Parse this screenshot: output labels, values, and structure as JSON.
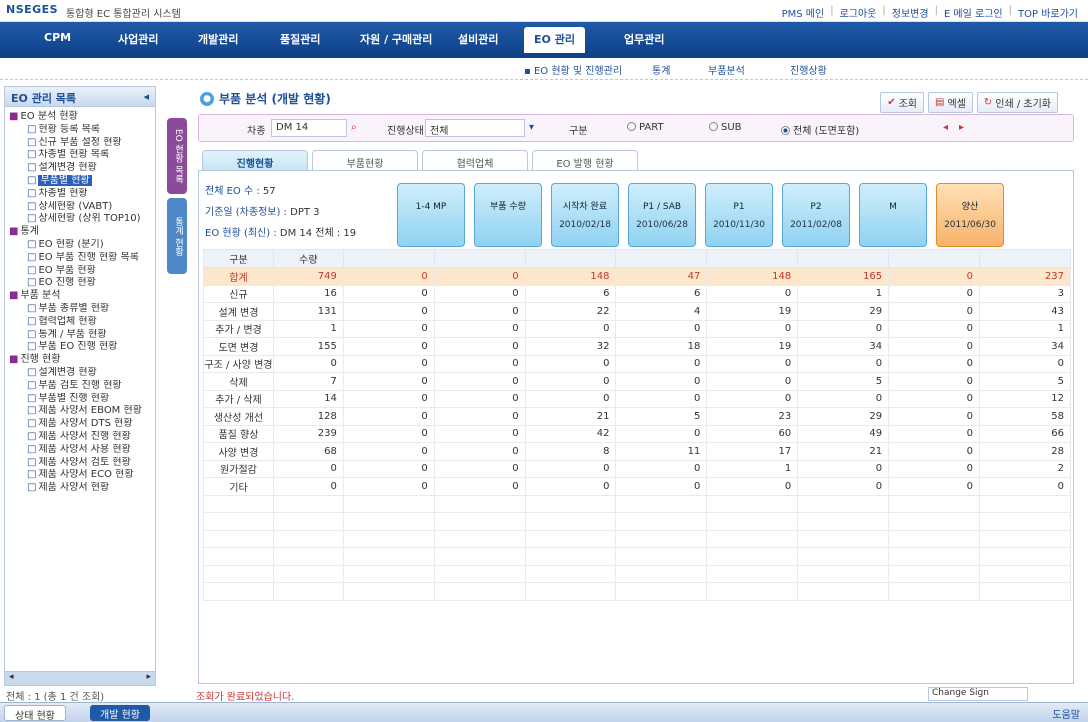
{
  "header": {
    "logo": "NSEGES",
    "title": "통합형 EC 통합관리 시스템",
    "links": [
      "PMS 메인",
      "로그아웃",
      "정보변경",
      "E 메일 로그인",
      "TOP 바로가기"
    ]
  },
  "mainnav": {
    "items": [
      "CPM",
      "사업관리",
      "개발관리",
      "품질관리",
      "자원 / 구매관리",
      "설비관리",
      "EO 관리",
      "업무관리"
    ],
    "active_index": 6
  },
  "subnav": {
    "items": [
      "EO 현황 및 진행관리",
      "통계",
      "부품분석",
      "진행상황"
    ],
    "active_index": 0
  },
  "left_panel": {
    "title": "EO 관리 목록",
    "tree": [
      {
        "group": "EO 분석 현황",
        "leaves": [
          "현황 등록 목록",
          "신규 부품 설정 현황",
          "차종별 현황 목록",
          "설계변경 현황",
          "부품별 현황",
          "차종별 현황",
          "상세현황 (VABT)",
          "상세현황 (상위 TOP10)"
        ],
        "selected": 4
      },
      {
        "group": "통계",
        "leaves": [
          "EO 현황 (분기)",
          "EO 부품 진행 현황 목록",
          "EO 부품 현황",
          "EO 진행 현황"
        ],
        "selected": -1
      },
      {
        "group": "부품 분석",
        "leaves": [
          "부품 종류별 현황",
          "협력업체 현황",
          "통계 / 부품 현황",
          "부품 EO 진행 현황"
        ],
        "selected": -1
      },
      {
        "group": "진행 현황",
        "leaves": [
          "설계변경 현황",
          "부품 검토 진행 현황",
          "부품별 진행 현황",
          "제품 사양서 EBOM 현황",
          "제품 사양서 DTS 현황",
          "제품 사양서 진행 현황",
          "제품 사양서 사용 현황",
          "제품 사양서 검토 현황",
          "제품 사양서 ECO 현황",
          "제품 사양서 현황"
        ],
        "selected": -1
      }
    ]
  },
  "vtabs": [
    "EO 현황 목록",
    "통계 현황"
  ],
  "page": {
    "title": "부품 분석 (개발 현황)",
    "actions": [
      "조회",
      "엑셀",
      "인쇄 / 초기화"
    ]
  },
  "filters": {
    "year_label": "차종",
    "year_value": "DM 14",
    "status_label": "진행상태",
    "status_value": "전체",
    "radio_group_label": "구분",
    "radios": [
      "PART",
      "SUB",
      "전체 (도면포함)"
    ],
    "radio_selected": 2
  },
  "tabs": [
    "진행현황",
    "부품현황",
    "협력업체",
    "EO 발행 현황"
  ],
  "active_tab": 0,
  "summary": {
    "line1_label": "전체 EO 수 :",
    "line1_value": "57",
    "line2_label": "기준일 (차종정보) :",
    "line2_value": "DPT 3",
    "line3_label": "EO 현황 (최신) :",
    "line3_value": "DM 14 전체 : 19"
  },
  "stages": [
    {
      "name": "1-4 MP",
      "date": ""
    },
    {
      "name": "부품 수량",
      "date": ""
    },
    {
      "name": "시작차 완료",
      "date": "2010/02/18"
    },
    {
      "name": "P1 / SAB",
      "date": "2010/06/28"
    },
    {
      "name": "P1",
      "date": "2010/11/30"
    },
    {
      "name": "P2",
      "date": "2011/02/08"
    },
    {
      "name": "M",
      "date": ""
    },
    {
      "name": "양산",
      "date": "2011/06/30"
    }
  ],
  "table": {
    "headers": [
      "구분",
      "수량",
      "",
      "",
      "",
      "",
      "",
      "",
      "",
      ""
    ],
    "total": {
      "label": "합계",
      "values": [
        "749",
        "0",
        "0",
        "148",
        "47",
        "148",
        "165",
        "0",
        "237"
      ]
    },
    "rows": [
      {
        "label": "신규",
        "values": [
          "16",
          "0",
          "0",
          "6",
          "6",
          "0",
          "1",
          "0",
          "3"
        ]
      },
      {
        "label": "설계 변경",
        "values": [
          "131",
          "0",
          "0",
          "22",
          "4",
          "19",
          "29",
          "0",
          "43"
        ]
      },
      {
        "label": "추가 / 변경",
        "values": [
          "1",
          "0",
          "0",
          "0",
          "0",
          "0",
          "0",
          "0",
          "1"
        ]
      },
      {
        "label": "도면 변경",
        "values": [
          "155",
          "0",
          "0",
          "32",
          "18",
          "19",
          "34",
          "0",
          "34"
        ]
      },
      {
        "label": "구조 / 사양 변경",
        "values": [
          "0",
          "0",
          "0",
          "0",
          "0",
          "0",
          "0",
          "0",
          "0"
        ]
      },
      {
        "label": "삭제",
        "values": [
          "7",
          "0",
          "0",
          "0",
          "0",
          "0",
          "5",
          "0",
          "5"
        ]
      },
      {
        "label": "추가 / 삭제",
        "values": [
          "14",
          "0",
          "0",
          "0",
          "0",
          "0",
          "0",
          "0",
          "12"
        ]
      },
      {
        "label": "생산성 개선",
        "values": [
          "128",
          "0",
          "0",
          "21",
          "5",
          "23",
          "29",
          "0",
          "58"
        ]
      },
      {
        "label": "품질 향상",
        "values": [
          "239",
          "0",
          "0",
          "42",
          "0",
          "60",
          "49",
          "0",
          "66"
        ]
      },
      {
        "label": "사양 변경",
        "values": [
          "68",
          "0",
          "0",
          "8",
          "11",
          "17",
          "21",
          "0",
          "28"
        ]
      },
      {
        "label": "원가절감",
        "values": [
          "0",
          "0",
          "0",
          "0",
          "0",
          "1",
          "0",
          "0",
          "2"
        ]
      },
      {
        "label": "기타",
        "values": [
          "0",
          "0",
          "0",
          "0",
          "0",
          "0",
          "0",
          "0",
          "0"
        ]
      }
    ],
    "empty_rows": 6
  },
  "status": {
    "left": "전체 : 1 (총 1 건 조회)",
    "message": "조회가 완료되었습니다.",
    "select_value": "Change Sign"
  },
  "bottom": {
    "tabs": [
      "상태 현황",
      "개발 현황"
    ],
    "right": "도움말"
  }
}
